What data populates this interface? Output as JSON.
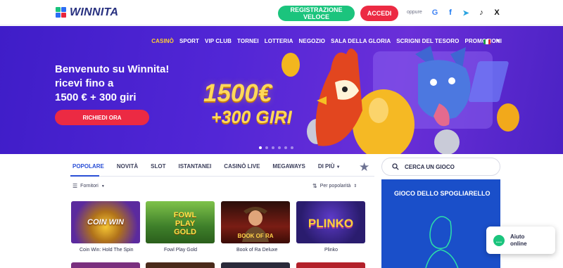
{
  "header": {
    "logo_text": "WINNITA",
    "register_label": "REGISTRAZIONE VELOCE",
    "login_label": "ACCEDI",
    "or_label": "oppure",
    "social": [
      {
        "name": "google-icon",
        "glyph": "G",
        "color": "#4285f4"
      },
      {
        "name": "facebook-icon",
        "glyph": "f",
        "color": "#1877f2"
      },
      {
        "name": "telegram-icon",
        "glyph": "➤",
        "color": "#2aa3e0"
      },
      {
        "name": "tiktok-icon",
        "glyph": "♪",
        "color": "#111111"
      },
      {
        "name": "x-icon",
        "glyph": "X",
        "color": "#111111"
      }
    ]
  },
  "nav": {
    "items": [
      "CASINÒ",
      "SPORT",
      "VIP CLUB",
      "TORNEI",
      "LOTTERIA",
      "NEGOZIO",
      "SALA DELLA GLORIA",
      "SCRIGNI DEL TESORO",
      "PROMOZIONI"
    ],
    "active": "CASINÒ",
    "language_flag": "Italian flag"
  },
  "hero": {
    "title_lines": [
      "Benvenuto su Winnita!",
      "ricevi fino a",
      "1500 € + 300 giri"
    ],
    "cta_label": "RICHIEDI ORA",
    "promo_amount": "1500€",
    "promo_spins": "+300 GIRI",
    "slides_count": 6,
    "active_slide": 1
  },
  "games": {
    "tabs": [
      "POPOLARE",
      "NOVITÀ",
      "SLOT",
      "ISTANTANEI",
      "CASINÒ LIVE",
      "MEGAWAYS",
      "DI PIÙ"
    ],
    "active_tab": "POPOLARE",
    "search_placeholder": "CERCA UN GIOCO",
    "providers_label": "Fornitori",
    "sort_label": "Per popolarità",
    "tiles": [
      {
        "name": "Coin Win: Hold The Spin",
        "art_text": "COIN WIN",
        "bg": "#5b2a9e"
      },
      {
        "name": "Fowl Play Gold",
        "art_text": "FOWL PLAY GOLD",
        "bg": "#3e7f2a"
      },
      {
        "name": "Book of Ra Deluxe",
        "art_text": "BOOK OF RA",
        "bg": "#7a1d14"
      },
      {
        "name": "Plinko",
        "art_text": "PLINKO",
        "bg": "#2a1c6e"
      }
    ]
  },
  "sidebar": {
    "promo_title": "GIOCO DELLO SPOGLIARELLO"
  },
  "chat": {
    "label": "Aiuto online"
  }
}
